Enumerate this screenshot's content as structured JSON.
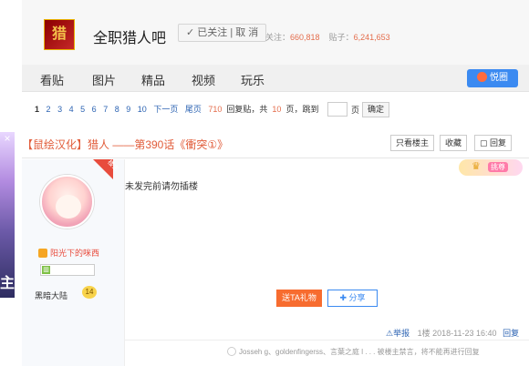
{
  "left_ad": {
    "close_glyph": "×",
    "glyph": "主"
  },
  "forum": {
    "logo_text": "猎",
    "title": "全职猎人吧",
    "follow_label": "✓ 已关注 | 取 消",
    "stats": {
      "follow_prefix": "关注：",
      "follow_count": "660,818",
      "posts_prefix": "贴子：",
      "posts_count": "6,241,653"
    }
  },
  "nav": {
    "items": [
      "看贴",
      "图片",
      "精品",
      "视频",
      "玩乐"
    ],
    "yuebo_label": "悦圈",
    "icon": "user-icon"
  },
  "pager": {
    "current": "1",
    "pages": [
      "2",
      "3",
      "4",
      "5",
      "6",
      "7",
      "8",
      "9",
      "10"
    ],
    "next": "下一页",
    "last": "尾页",
    "reply_count": "710",
    "reply_suffix": "回复贴，共",
    "total_pages": "10",
    "pages_suffix": "页，跳到",
    "jump_suffix": "页",
    "confirm_label": "确定"
  },
  "thread": {
    "title": "【鼠绘汉化】猎人 ——第390话《衝突①》",
    "buttons": {
      "only_op": "只看楼主",
      "collect": "收藏",
      "reply": "回复"
    }
  },
  "author": {
    "badge": "楼主",
    "name": "阳光下的咪西",
    "rank_title": "黑暗大陆",
    "rank_level": "14"
  },
  "post": {
    "text": "未发完前请勿插楼",
    "medal_label": "挑尊",
    "gift_label": "送TA礼物",
    "share_label": "分享",
    "report_label": "举报",
    "floor": "1楼",
    "time": "2018-11-23 16:40",
    "reply_label": "回复",
    "ignore_text": "Josseh g、goldenfingerss、言葉之庭 l . . . 被楼主禁言，将不能再进行回复"
  },
  "colors": {
    "accent_blue": "#3b8af1",
    "accent_red": "#e15c3a",
    "gift_orange": "#f76c2f"
  }
}
